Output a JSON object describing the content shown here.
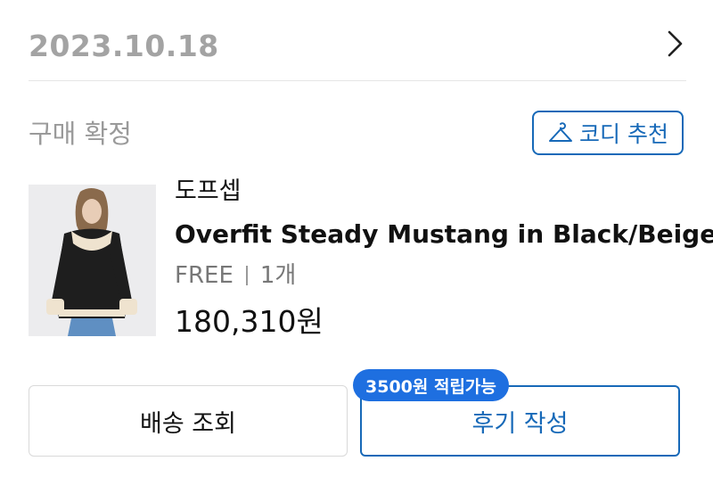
{
  "order": {
    "date": "2023.10.18",
    "status": "구매 확정",
    "cody_button_label": "코디 추천"
  },
  "product": {
    "brand": "도프셉",
    "name": "Overfit Steady Mustang in Black/Beige",
    "size": "FREE",
    "quantity": "1개",
    "price": "180,310원",
    "image": "product-photo-jacket"
  },
  "actions": {
    "shipping_label": "배송 조회",
    "review_label": "후기 작성",
    "review_badge": "3500원 적립가능"
  },
  "colors": {
    "accent": "#1769b8",
    "badge": "#1e6fe0",
    "muted": "#a3a3a3"
  },
  "icons": {
    "header": "chevron-right-icon",
    "cody": "hanger-icon"
  }
}
